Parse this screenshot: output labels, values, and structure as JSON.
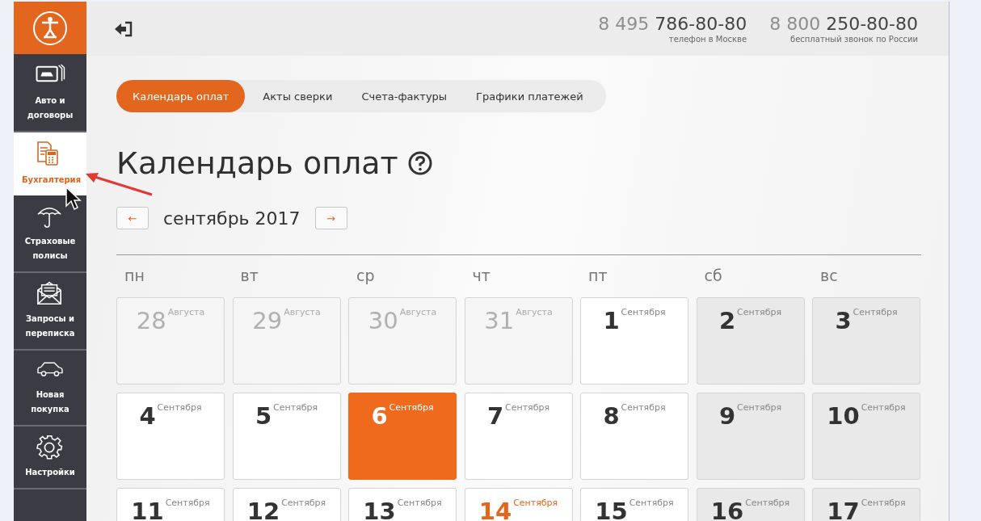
{
  "sidebar": {
    "items": [
      {
        "label": "Авто и договоры",
        "kind": "cards",
        "selected": false
      },
      {
        "label": "Бухгалтерия",
        "kind": "docs",
        "selected": true
      },
      {
        "label": "Страховые полисы",
        "kind": "umbrella",
        "selected": false
      },
      {
        "label": "Запросы и переписка",
        "kind": "mail",
        "selected": false
      },
      {
        "label": "Новая покупка",
        "kind": "car",
        "selected": false
      },
      {
        "label": "Настройки",
        "kind": "gear",
        "selected": false
      }
    ]
  },
  "header": {
    "phones": [
      {
        "number": "8 495 **786-80-80**",
        "caption": "телефон в Москве"
      },
      {
        "number": "8 800 **250-80-80**",
        "caption": "бесплатный звонок по России"
      }
    ]
  },
  "tabs": [
    {
      "label": "Календарь оплат",
      "selected": true
    },
    {
      "label": "Акты сверки",
      "selected": false
    },
    {
      "label": "Счета-фактуры",
      "selected": false
    },
    {
      "label": "Графики платежей",
      "selected": false
    }
  ],
  "page_title": "Календарь оплат",
  "month_nav": {
    "prev": "←",
    "month": "сентябрь 2017",
    "next": "→"
  },
  "calendar": {
    "weekdays": [
      "пн",
      "вт",
      "ср",
      "чт",
      "пт",
      "сб",
      "вс"
    ],
    "days": [
      {
        "day": "28",
        "month": "Августа",
        "kind": "past"
      },
      {
        "day": "29",
        "month": "Августа",
        "kind": "past"
      },
      {
        "day": "30",
        "month": "Августа",
        "kind": "past"
      },
      {
        "day": "31",
        "month": "Августа",
        "kind": "past"
      },
      {
        "day": "1",
        "month": "Сентября",
        "kind": "normal"
      },
      {
        "day": "2",
        "month": "Сентября",
        "kind": "weekend"
      },
      {
        "day": "3",
        "month": "Сентября",
        "kind": "weekend"
      },
      {
        "day": "4",
        "month": "Сентября",
        "kind": "normal"
      },
      {
        "day": "5",
        "month": "Сентября",
        "kind": "normal"
      },
      {
        "day": "6",
        "month": "Сентября",
        "kind": "today"
      },
      {
        "day": "7",
        "month": "Сентября",
        "kind": "normal"
      },
      {
        "day": "8",
        "month": "Сентября",
        "kind": "normal"
      },
      {
        "day": "9",
        "month": "Сентября",
        "kind": "weekend"
      },
      {
        "day": "10",
        "month": "Сентября",
        "kind": "weekend"
      },
      {
        "day": "11",
        "month": "Сентября",
        "kind": "normal"
      },
      {
        "day": "12",
        "month": "Сентября",
        "kind": "normal"
      },
      {
        "day": "13",
        "month": "Сентября",
        "kind": "normal"
      },
      {
        "day": "14",
        "month": "Сентября",
        "kind": "payment"
      },
      {
        "day": "15",
        "month": "Сентября",
        "kind": "normal"
      },
      {
        "day": "16",
        "month": "Сентября",
        "kind": "weekend"
      },
      {
        "day": "17",
        "month": "Сентября",
        "kind": "weekend"
      }
    ]
  }
}
